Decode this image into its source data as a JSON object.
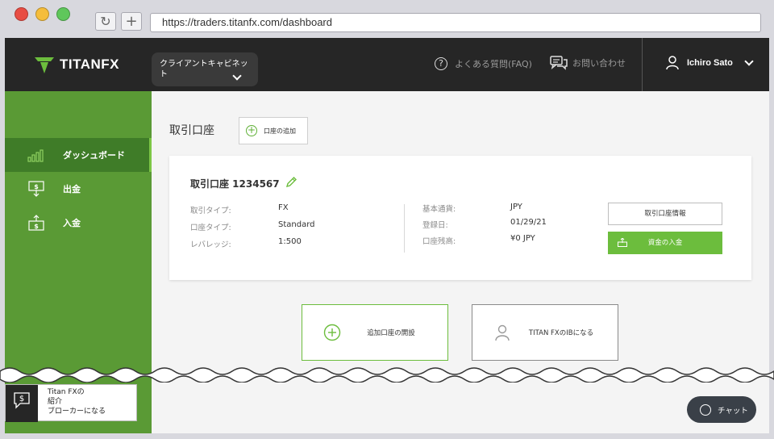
{
  "browser": {
    "url": "https://traders.titanfx.com/dashboard",
    "reload_icon": "reload-icon",
    "new_tab_icon": "plus-icon"
  },
  "header": {
    "logo_text": "TITANFX",
    "cabinet_label": "クライアントキャビネット",
    "faq_label": "よくある質問(FAQ)",
    "contact_label": "お問い合わせ",
    "user_name": "Ichiro Sato"
  },
  "sidebar": {
    "items": [
      {
        "label": "ダッシュボード",
        "icon": "bar-chart-icon",
        "active": true
      },
      {
        "label": "出金",
        "icon": "withdraw-icon",
        "active": false
      },
      {
        "label": "入金",
        "icon": "deposit-icon",
        "active": false
      }
    ]
  },
  "main": {
    "title": "取引口座",
    "add_account_label": "口座の追加",
    "account": {
      "title": "取引口座 1234567",
      "left": [
        {
          "key": "取引タイプ:",
          "value": "FX"
        },
        {
          "key": "口座タイプ:",
          "value": "Standard"
        },
        {
          "key": "レバレッジ:",
          "value": "1:500"
        }
      ],
      "right": [
        {
          "key": "基本通貨:",
          "value": "JPY"
        },
        {
          "key": "登録日:",
          "value": "01/29/21"
        },
        {
          "key": "口座残高:",
          "value": "¥0 JPY"
        }
      ],
      "info_button": "取引口座情報",
      "deposit_button": "資金の入金"
    },
    "tiles": {
      "open_account": "追加口座の開設",
      "become_ib": "TITAN FXのIBになる"
    }
  },
  "widgets": {
    "ib_line1": "Titan FXの",
    "ib_line2": "紹介",
    "ib_line3": "ブローカーになる",
    "chat_label": "チャット"
  },
  "colors": {
    "header_bg": "#262626",
    "sidebar_green": "#5a9a35",
    "sidebar_active": "#3f7c28",
    "accent_green": "#6cbd3d"
  }
}
